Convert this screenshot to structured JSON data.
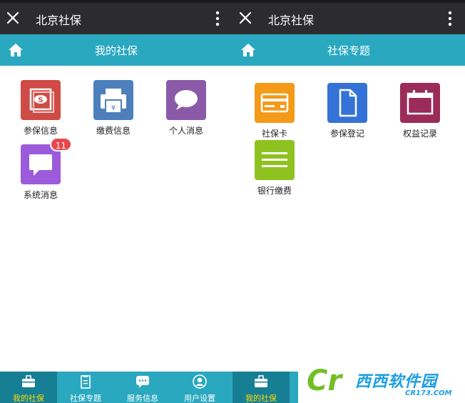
{
  "left": {
    "app_title": "北京社保",
    "header_title": "我的社保",
    "tiles": [
      {
        "label": "参保信息",
        "icon": "social-security-seal-icon",
        "color": "#cf4b46"
      },
      {
        "label": "缴费信息",
        "icon": "printer-icon",
        "color": "#4d7fbd"
      },
      {
        "label": "个人消息",
        "icon": "chat-bubble-icon",
        "color": "#8a5aa8"
      },
      {
        "label": "系统消息",
        "icon": "chat-bubble-icon",
        "color": "#9b5bdb",
        "badge": "11"
      }
    ]
  },
  "right": {
    "app_title": "北京社保",
    "header_title": "社保专题",
    "tiles": [
      {
        "label": "社保卡",
        "icon": "card-icon",
        "color": "#f39a19"
      },
      {
        "label": "参保登记",
        "icon": "document-icon",
        "color": "#3472d8"
      },
      {
        "label": "权益记录",
        "icon": "calendar-icon",
        "color": "#9b2b58"
      },
      {
        "label": "银行缴费",
        "icon": "lines-icon",
        "color": "#8dc21f"
      }
    ]
  },
  "tabbar": {
    "tabs": [
      {
        "label": "我的社保",
        "icon": "briefcase-icon",
        "active": true
      },
      {
        "label": "社保专题",
        "icon": "clipboard-icon"
      },
      {
        "label": "服务信息",
        "icon": "message-icon"
      },
      {
        "label": "用户设置",
        "icon": "user-icon"
      },
      {
        "label": "我的社保",
        "icon": "briefcase-icon",
        "active": true
      }
    ]
  },
  "watermark": {
    "brand": "西西软件园",
    "url": "CR173.COM"
  },
  "colors": {
    "topbar": "#2c2c2e",
    "accent": "#2aa8bf",
    "tab_active": "#167f94",
    "badge": "#e8474a"
  }
}
